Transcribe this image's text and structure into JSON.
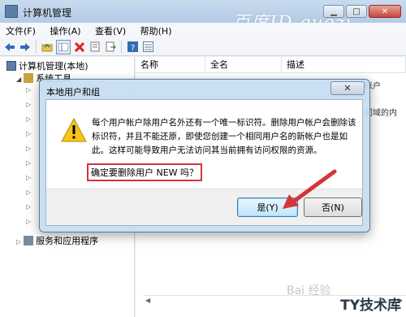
{
  "window": {
    "title": "计算机管理",
    "watermark": "百度ID guozi",
    "caption": {
      "minimize": "▁",
      "maximize": "□",
      "close": "✕"
    }
  },
  "menu": [
    "文件(F)",
    "操作(A)",
    "查看(V)",
    "帮助(H)"
  ],
  "toolbar": [
    "back-arrow-icon",
    "forward-arrow-icon",
    "up-folder-icon",
    "show-hide-tree-icon",
    "delete-icon",
    "properties-icon",
    "export-icon",
    "help-icon",
    "details-view-icon"
  ],
  "tree": {
    "root": "计算机管理(本地)",
    "system_tools": "系统工具",
    "services": "服务和应用程序"
  },
  "list": {
    "columns": [
      "名称",
      "全名",
      "描述"
    ],
    "partial_rows": [
      "帐户",
      "问域的内"
    ]
  },
  "dialog": {
    "title": "本地用户和组",
    "close": "✕",
    "message": "每个用户帐户除用户名外还有一个唯一标识符。删除用户帐户会删除该标识符，并且不能还原，即使您创建一个相同用户名的新帐户也是如此。这样可能导致用户无法访问其当前拥有访问权限的资源。",
    "confirm": "确定要删除用户 NEW 吗？",
    "yes": "是(Y)",
    "no": "否(N)"
  },
  "watermark_bottom": "Bai 经验",
  "brand": "TY技术库",
  "colors": {
    "accent_red": "#d4343a",
    "title_bar": "#c9dbee",
    "dialog_frame": "#c6dcf1"
  }
}
